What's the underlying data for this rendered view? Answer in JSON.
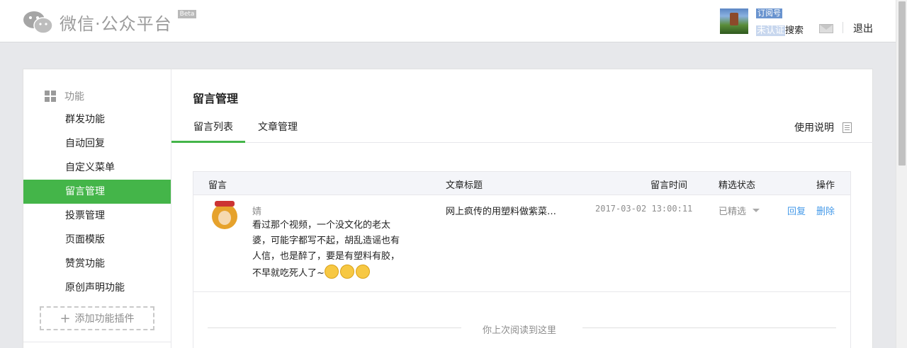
{
  "header": {
    "logo_text": "微信·公众平台",
    "beta_label": "Beta",
    "account_type": "订阅号",
    "account_status_badge": "未认证",
    "account_status_text": "搜索",
    "logout_label": "退出"
  },
  "sidebar": {
    "section_title": "功能",
    "items": [
      {
        "label": "群发功能"
      },
      {
        "label": "自动回复"
      },
      {
        "label": "自定义菜单"
      },
      {
        "label": "留言管理"
      },
      {
        "label": "投票管理"
      },
      {
        "label": "页面模版"
      },
      {
        "label": "赞赏功能"
      },
      {
        "label": "原创声明功能"
      }
    ],
    "active_index": 3,
    "add_plugin_label": "添加功能插件"
  },
  "main": {
    "page_title": "留言管理",
    "tabs": [
      {
        "label": "留言列表"
      },
      {
        "label": "文章管理"
      }
    ],
    "help_label": "使用说明",
    "table": {
      "headers": [
        "留言",
        "文章标题",
        "留言时间",
        "精选状态",
        "操作"
      ],
      "rows": [
        {
          "username": "婧",
          "comment_lines": [
            "看过那个视频，一个没文化的老太",
            "婆，可能字都写不起，胡乱造谣也有",
            "人信，也是醉了，要是有塑料有胶，",
            "不早就吃死人了~"
          ],
          "article": "网上疯传的用塑料做紫菜…",
          "time": "2017-03-02 13:00:11",
          "state": "已精选",
          "reply_label": "回复",
          "delete_label": "删除"
        }
      ],
      "last_read_label": "你上次阅读到这里"
    }
  },
  "colors": {
    "accent_green": "#44b549",
    "link_blue": "#459ae9",
    "page_bg": "#e7e8eb"
  }
}
